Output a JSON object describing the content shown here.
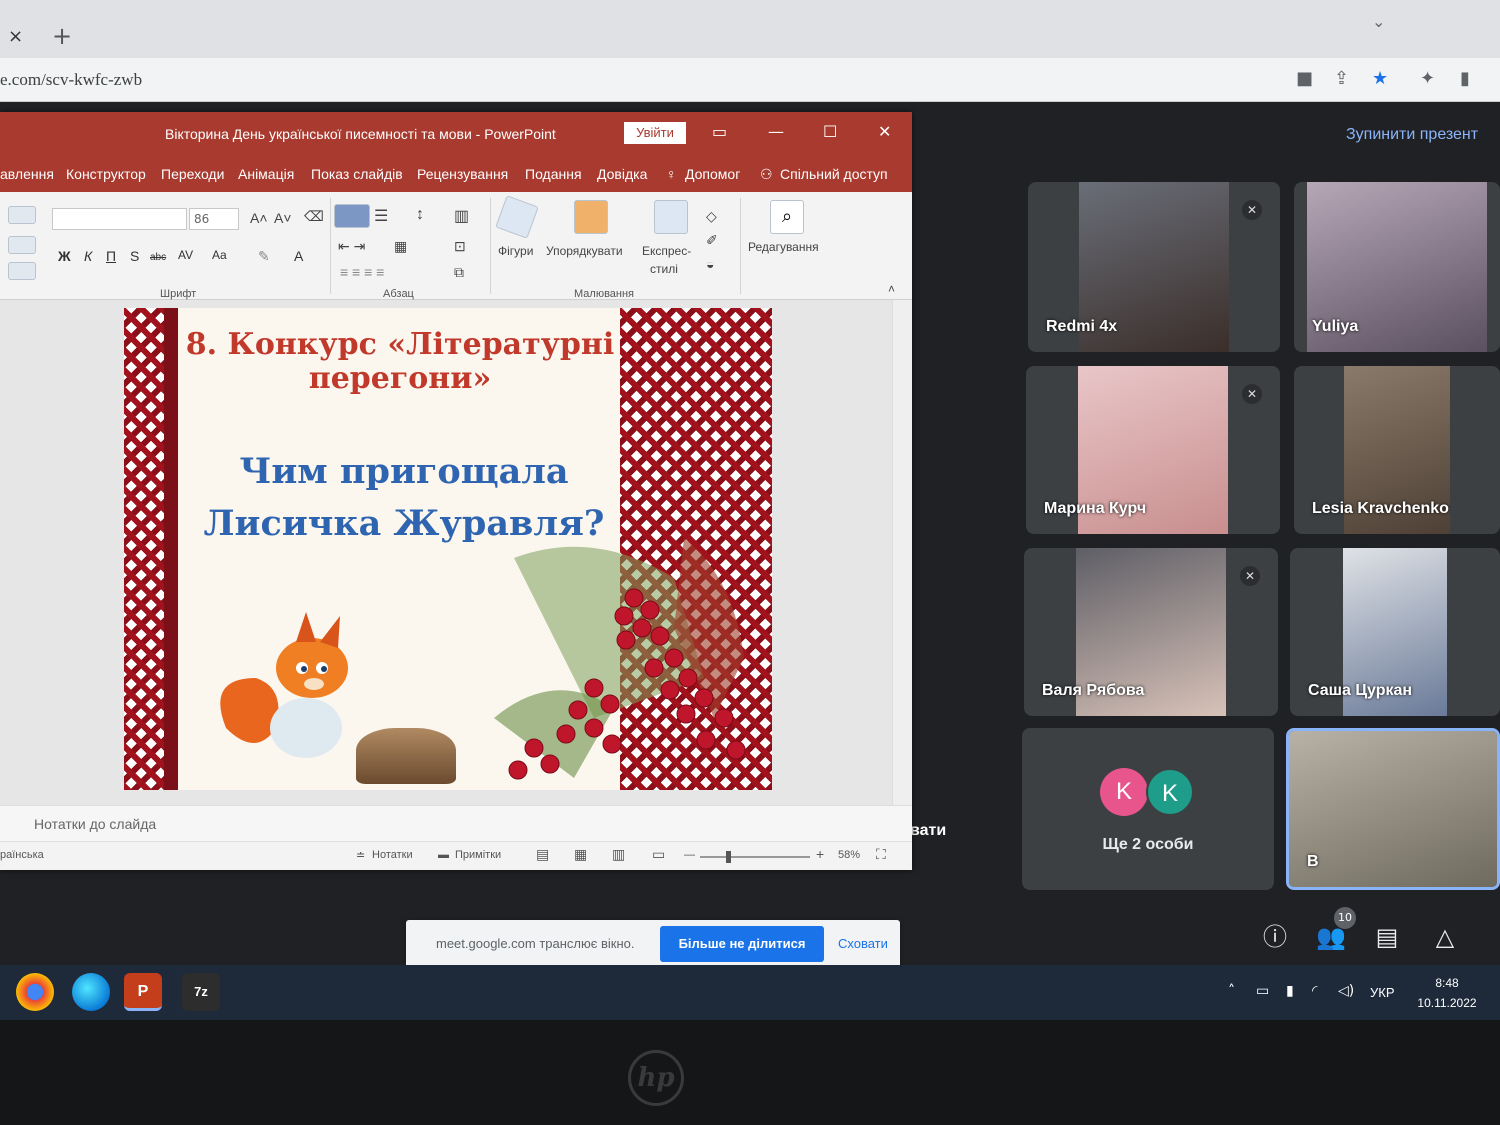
{
  "browser": {
    "url": "e.com/scv-kwfc-zwb",
    "tab_close": "×",
    "new_tab": "+"
  },
  "meet": {
    "stop_presenting": "Зупинити презент",
    "participants": [
      {
        "name": "Redmi 4x",
        "muted": true
      },
      {
        "name": "Yuliya",
        "muted": false
      },
      {
        "name": "Марина Курч",
        "muted": true
      },
      {
        "name": "Lesia Kravchenko",
        "muted": false
      },
      {
        "name": "Валя Рябова",
        "muted": true
      },
      {
        "name": "Саша Цуркан",
        "muted": false
      }
    ],
    "more": {
      "label": "Ще 2 особи",
      "avatars": [
        "K",
        "K"
      ],
      "avatar_colors": [
        "#e8548c",
        "#1e9e8a"
      ]
    },
    "self_initial": "B",
    "side_text": "вати",
    "people_count": "10",
    "share_banner": {
      "text": "meet.google.com транслює вікно.",
      "stop_button": "Більше не ділитися",
      "hide_button": "Сховати"
    }
  },
  "powerpoint": {
    "window_title": "Вікторина День української писемності та мови  -  PowerPoint",
    "sign_in": "Увійти",
    "ribbon_tabs": [
      "авлення",
      "Конструктор",
      "Переходи",
      "Анімація",
      "Показ слайдів",
      "Рецензування",
      "Подання",
      "Довідка",
      "Допомог",
      "Спільний доступ"
    ],
    "font_size": "86",
    "format_buttons": [
      "Ж",
      "К",
      "П",
      "S",
      "abc",
      "AV",
      "Aa",
      "A"
    ],
    "drawing_buttons": [
      "Фігури",
      "Упорядкувати",
      "Експрес-",
      "стилі"
    ],
    "editing_button": "Редагування",
    "groups": [
      "Шрифт",
      "Абзац",
      "Малювання"
    ],
    "slide": {
      "title_line1": "8. Конкурс «Літературні",
      "title_line2": "перегони»",
      "question_line1": "Чим пригощала",
      "question_line2": "Лисичка Журавля?"
    },
    "notes_placeholder": "Нотатки до слайда",
    "status": {
      "language": "раїнська",
      "notes": "Нотатки",
      "comments": "Примітки",
      "zoom": "58%"
    }
  },
  "taskbar": {
    "apps": [
      "chrome",
      "edge",
      "powerpoint",
      "7z"
    ],
    "language": "УКР",
    "time": "8:48",
    "date": "10.11.2022"
  },
  "laptop_brand": "hp",
  "colors": {
    "ppt_accent": "#a83a2f",
    "meet_bg": "#202124",
    "link_blue": "#1a73e8",
    "slide_title_red": "#c0392b",
    "slide_question_blue": "#2f64b0"
  }
}
